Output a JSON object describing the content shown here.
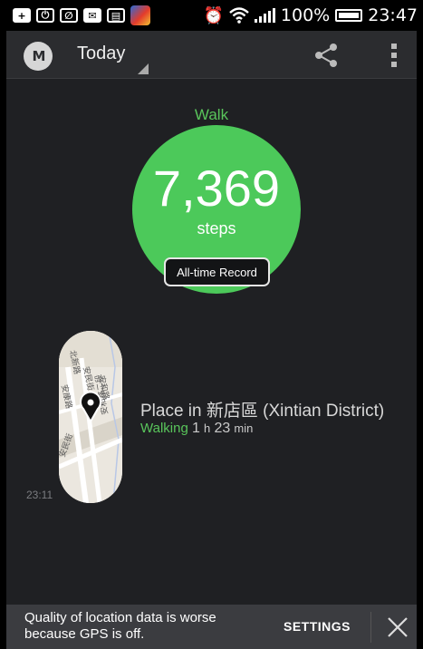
{
  "status_bar": {
    "battery_percent": "100%",
    "time": "23:47",
    "icons": [
      "plus-icon",
      "power-icon",
      "leaf-icon",
      "mail-icon",
      "keyboard-icon",
      "game-app-icon",
      "alarm-icon",
      "wifi-icon",
      "signal-icon",
      "battery-icon"
    ]
  },
  "app_bar": {
    "logo": "M",
    "period": "Today"
  },
  "summary": {
    "activity": "Walk",
    "value": "7,369",
    "unit": "steps",
    "badge": "All-time Record",
    "accent_color": "#4cc95a"
  },
  "place": {
    "time": "23:11",
    "title": "Place in 新店區 (Xintian District)",
    "activity": "Walking",
    "duration_h": "1",
    "unit_h": "h",
    "duration_m": "23",
    "unit_m": "min",
    "map_labels": [
      "北新路",
      "安民街",
      "安和路",
      "安康路",
      "安和路二段",
      "安民街"
    ]
  },
  "snackbar": {
    "message": "Quality of location data is worse because GPS is off.",
    "action": "SETTINGS"
  }
}
